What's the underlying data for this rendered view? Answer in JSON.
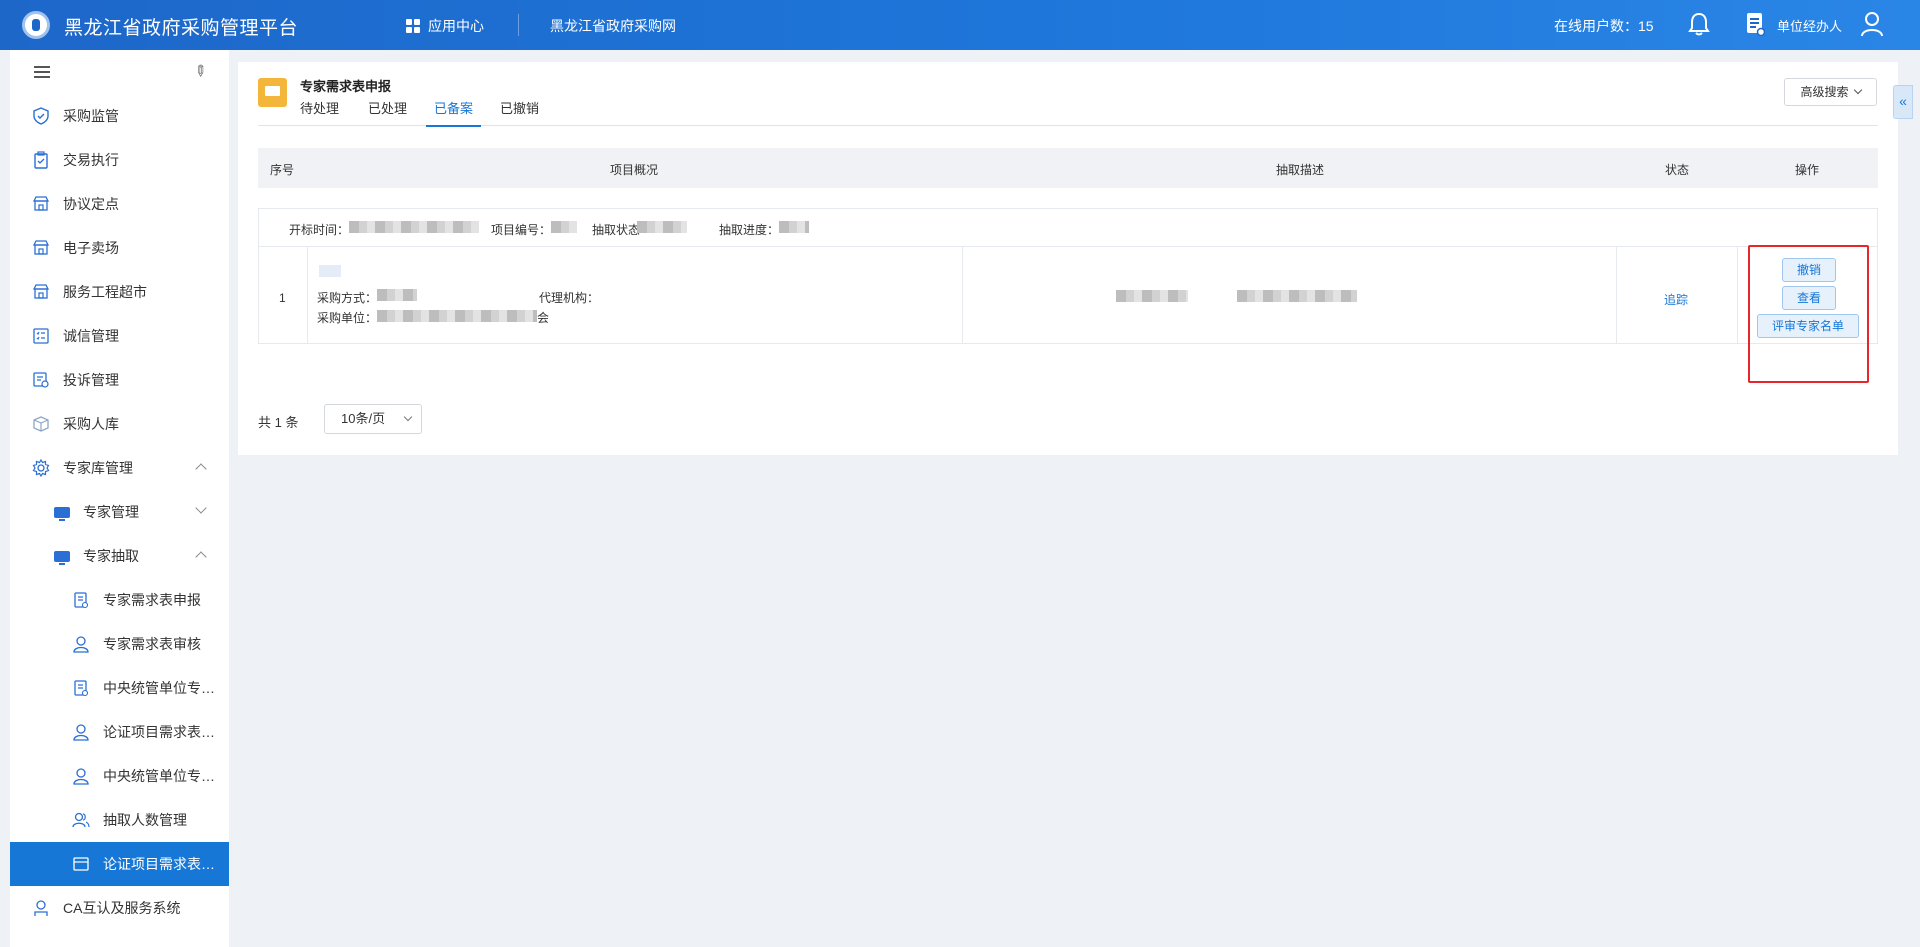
{
  "header": {
    "title": "黑龙江省政府采购管理平台",
    "app_center": "应用中心",
    "procurement_site": "黑龙江省政府采购网",
    "online_users": "在线用户数：15",
    "user_role": "单位经办人"
  },
  "sidebar": {
    "items": [
      {
        "label": "采购监管",
        "icon": "shield-icon"
      },
      {
        "label": "交易执行",
        "icon": "clipboard-icon"
      },
      {
        "label": "协议定点",
        "icon": "store-icon"
      },
      {
        "label": "电子卖场",
        "icon": "store-icon"
      },
      {
        "label": "服务工程超市",
        "icon": "store-icon"
      },
      {
        "label": "诚信管理",
        "icon": "list-icon"
      },
      {
        "label": "投诉管理",
        "icon": "complaint-icon"
      },
      {
        "label": "采购人库",
        "icon": "database-icon"
      },
      {
        "label": "专家库管理",
        "icon": "gear-icon"
      }
    ],
    "expert_sub": [
      {
        "label": "专家管理"
      },
      {
        "label": "专家抽取"
      }
    ],
    "extract_sub": [
      {
        "label": "专家需求表申报",
        "icon": "form-icon"
      },
      {
        "label": "专家需求表审核",
        "icon": "user-icon"
      },
      {
        "label": "中央统管单位专家需求表申报",
        "icon": "form-icon"
      },
      {
        "label": "论证项目需求表审核",
        "icon": "user-icon"
      },
      {
        "label": "中央统管单位专家需求表审核",
        "icon": "user-icon"
      },
      {
        "label": "抽取人数管理",
        "icon": "users-icon"
      },
      {
        "label": "论证项目需求表申报",
        "icon": "window-icon"
      }
    ],
    "bottom_item": {
      "label": "CA互认及服务系统",
      "icon": "ca-icon"
    }
  },
  "main": {
    "page_title": "专家需求表申报",
    "tabs": [
      "待处理",
      "已处理",
      "已备案",
      "已撤销"
    ],
    "active_tab": "已备案",
    "advanced_search": "高级搜索",
    "table": {
      "headers": [
        "序号",
        "项目概况",
        "抽取描述",
        "状态",
        "操作"
      ],
      "meta_labels": {
        "open_time": "开标时间：",
        "project_no": "项目编号：",
        "extract_state": "抽取状态",
        "extract_progress": "抽取进度："
      },
      "row": {
        "index": "1",
        "method_label": "采购方式：",
        "agency_label": "代理机构：",
        "unit_label": "采购单位：",
        "unit_suffix": "会",
        "status": "追踪",
        "actions": [
          "撤销",
          "查看",
          "评审专家名单"
        ]
      }
    },
    "pagination": {
      "total": "共 1 条",
      "page_size": "10条/页"
    }
  },
  "colors": {
    "primary": "#1677d7",
    "header": "#1d67c9",
    "highlight_box": "#e6262b",
    "page_icon": "#f4b63a"
  }
}
